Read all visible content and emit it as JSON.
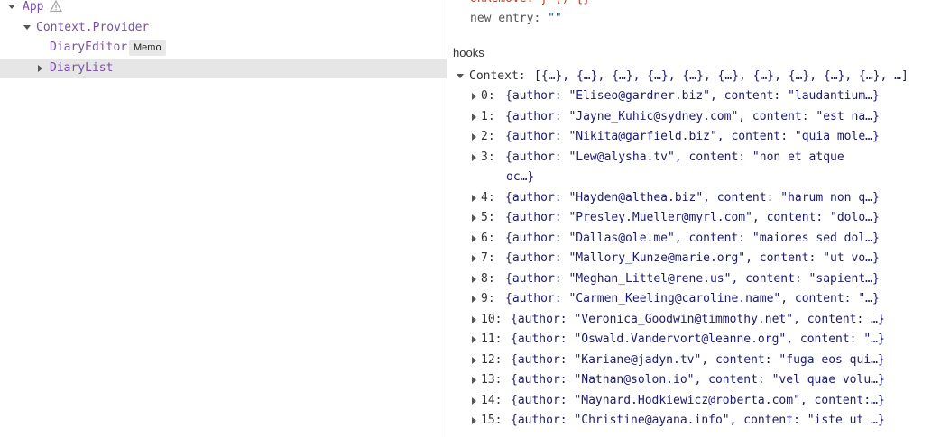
{
  "tree": {
    "app_label": "App",
    "provider_label": "Context.Provider",
    "editor_label": "DiaryEditor",
    "memo_badge": "Memo",
    "list_label": "DiaryList"
  },
  "props": {
    "onremove_line": "onRemove: ƒ () {}",
    "new_entry_key": "new entry:",
    "new_entry_value": "\"\""
  },
  "hooks": {
    "title": "hooks",
    "context_key": "Context:",
    "context_summary": "[{…}, {…}, {…}, {…}, {…}, {…}, {…}, {…}, {…}, {…}, …]",
    "entries": [
      {
        "index": "0:",
        "value": "{author: \"Eliseo@gardner.biz\", content: \"laudantium…}"
      },
      {
        "index": "1:",
        "value": "{author: \"Jayne_Kuhic@sydney.com\", content: \"est na…}"
      },
      {
        "index": "2:",
        "value": "{author: \"Nikita@garfield.biz\", content: \"quia mole…}"
      },
      {
        "index": "3:",
        "value": "{author: \"Lew@alysha.tv\", content: \"non et atque",
        "wrap": "oc…}"
      },
      {
        "index": "4:",
        "value": "{author: \"Hayden@althea.biz\", content: \"harum non q…}"
      },
      {
        "index": "5:",
        "value": "{author: \"Presley.Mueller@myrl.com\", content: \"dolo…}"
      },
      {
        "index": "6:",
        "value": "{author: \"Dallas@ole.me\", content: \"maiores sed dol…}"
      },
      {
        "index": "7:",
        "value": "{author: \"Mallory_Kunze@marie.org\", content: \"ut vo…}"
      },
      {
        "index": "8:",
        "value": "{author: \"Meghan_Littel@rene.us\", content: \"sapient…}"
      },
      {
        "index": "9:",
        "value": "{author: \"Carmen_Keeling@caroline.name\", content: \"…}"
      },
      {
        "index": "10:",
        "value": "{author: \"Veronica_Goodwin@timmothy.net\", content: …}"
      },
      {
        "index": "11:",
        "value": "{author: \"Oswald.Vandervort@leanne.org\", content: \"…}"
      },
      {
        "index": "12:",
        "value": "{author: \"Kariane@jadyn.tv\", content: \"fuga eos qui…}"
      },
      {
        "index": "13:",
        "value": "{author: \"Nathan@solon.io\", content: \"vel quae volu…}"
      },
      {
        "index": "14:",
        "value": "{author: \"Maynard.Hodkiewicz@roberta.com\", content:…}"
      },
      {
        "index": "15:",
        "value": "{author: \"Christine@ayana.info\", content: \"iste ut …}"
      }
    ]
  }
}
